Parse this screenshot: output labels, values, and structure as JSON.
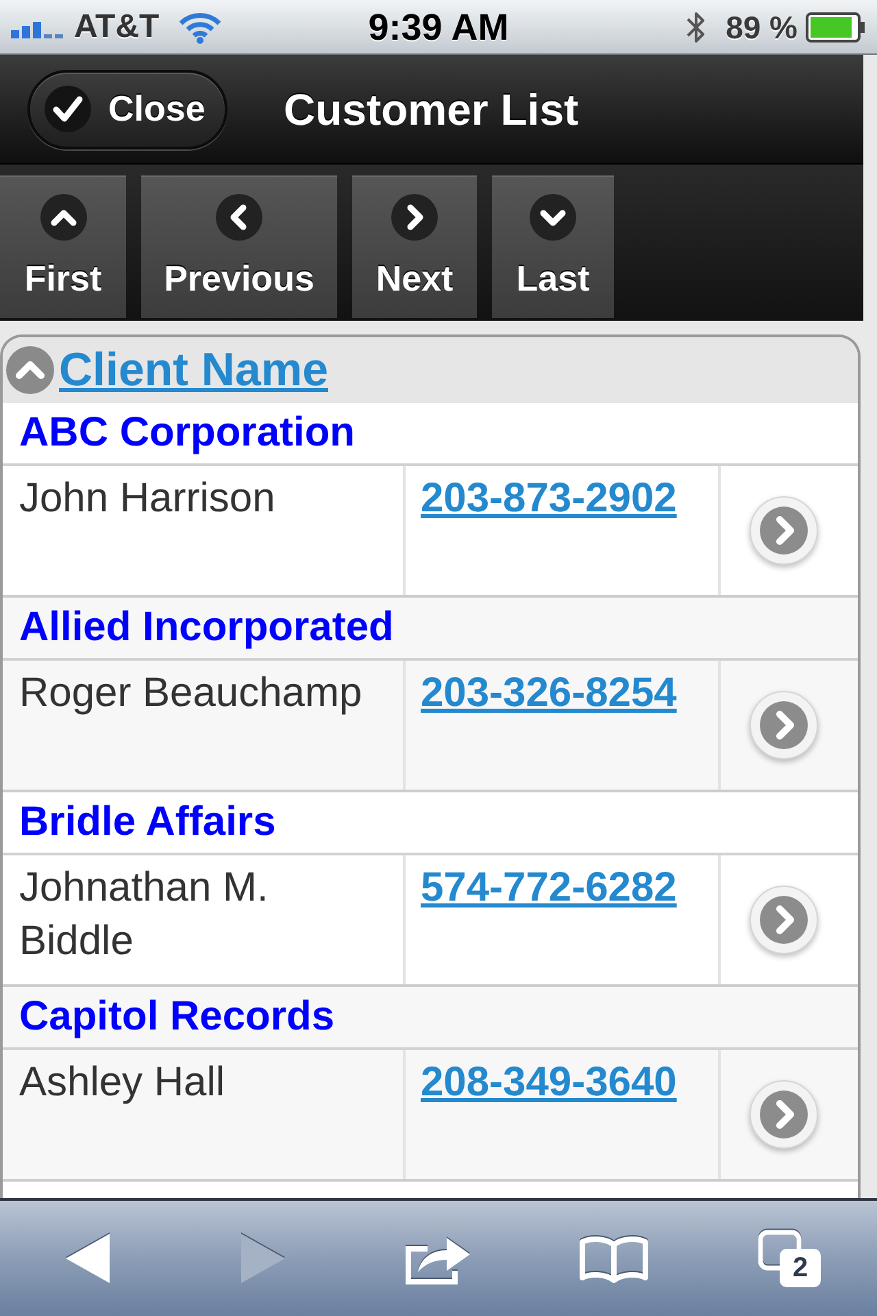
{
  "status_bar": {
    "carrier": "AT&T",
    "time": "9:39 AM",
    "battery": "89 %"
  },
  "header": {
    "close_button": "Close",
    "title": "Customer List"
  },
  "pager": [
    {
      "kind": "first",
      "label": "First"
    },
    {
      "kind": "previous",
      "label": "Previous"
    },
    {
      "kind": "next",
      "label": "Next"
    },
    {
      "kind": "last",
      "label": "Last"
    }
  ],
  "table": {
    "column": "Client Name",
    "groups": [
      {
        "name": "ABC Corporation",
        "rows": [
          {
            "contact": "John Harrison",
            "phone": "203-873-2902"
          }
        ]
      },
      {
        "name": "Allied Incorporated",
        "rows": [
          {
            "contact": "Roger Beauchamp",
            "phone": "203-326-8254"
          }
        ]
      },
      {
        "name": "Bridle Affairs",
        "rows": [
          {
            "contact": "Johnathan M. Biddle",
            "phone": "574-772-6282"
          }
        ]
      },
      {
        "name": "Capitol Records",
        "rows": [
          {
            "contact": "Ashley Hall",
            "phone": "208-349-3640"
          }
        ]
      }
    ]
  },
  "browser_toolbar": {
    "buttons": [
      {
        "kind": "back",
        "disabled": false
      },
      {
        "kind": "forward",
        "disabled": true
      },
      {
        "kind": "share",
        "disabled": false
      },
      {
        "kind": "bookmarks",
        "disabled": false
      },
      {
        "kind": "tabs",
        "disabled": false,
        "badge": "2"
      }
    ]
  }
}
